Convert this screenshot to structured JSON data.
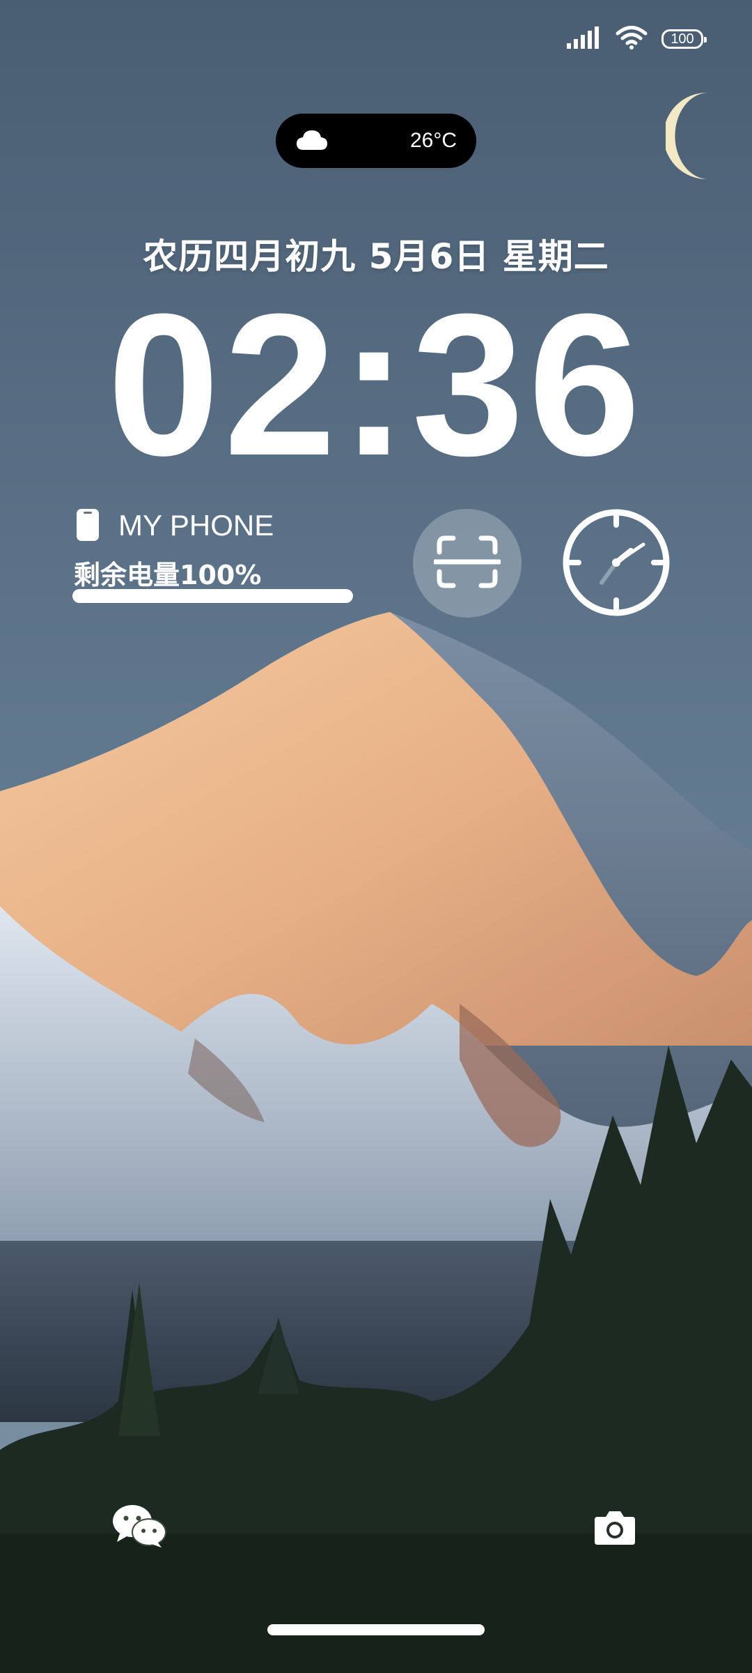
{
  "status_bar": {
    "signal_icon": "signal-icon",
    "wifi_icon": "wifi-icon",
    "battery_level": "100"
  },
  "weather": {
    "icon": "cloud-icon",
    "temperature": "26°C"
  },
  "lockscreen": {
    "date_line": "农历四月初九 5月6日 星期二",
    "time": "02:36"
  },
  "device_widget": {
    "icon": "phone-icon",
    "name": "MY PHONE",
    "battery_text": "剩余电量100%",
    "battery_fraction": 1.0
  },
  "quick_actions": {
    "scan_icon": "scan-icon",
    "clock_icon": "clock-icon"
  },
  "shortcuts": {
    "left_icon": "wechat-icon",
    "right_icon": "camera-icon"
  },
  "colors": {
    "sky_top": "#4b5f74",
    "sky_bottom": "#6e8aa0",
    "mountain_lit": "#e9b58a",
    "forest": "#1b2a20",
    "pill_bg": "#000000"
  }
}
